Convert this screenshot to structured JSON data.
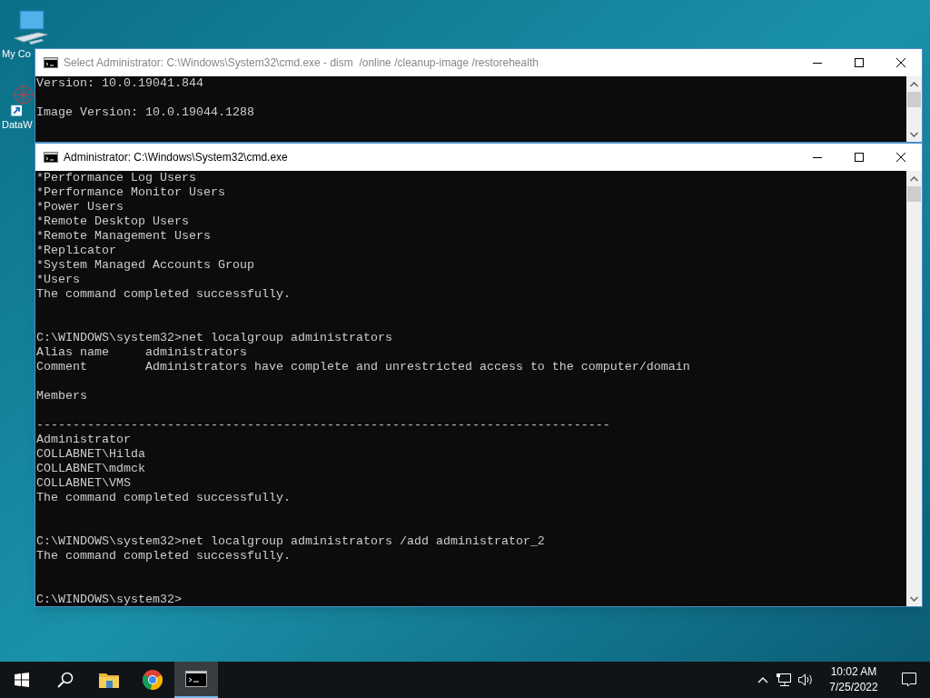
{
  "desktop_icons": [
    {
      "label": "My Co",
      "kind": "computer"
    },
    {
      "label": "DataW",
      "kind": "shortcut"
    }
  ],
  "windows": [
    {
      "title": "Select Administrator: C:\\Windows\\System32\\cmd.exe - dism  /online /cleanup-image /restorehealth",
      "active": false,
      "lines": [
        {
          "kind": "text",
          "text": "Version: 10.0.19041.844"
        },
        {
          "kind": "blank"
        },
        {
          "kind": "text",
          "text": "Image Version: 10.0.19044.1288"
        }
      ]
    },
    {
      "title": "Administrator: C:\\Windows\\System32\\cmd.exe",
      "active": true,
      "lines": [
        {
          "kind": "text",
          "text": "*Performance Log Users"
        },
        {
          "kind": "text",
          "text": "*Performance Monitor Users"
        },
        {
          "kind": "text",
          "text": "*Power Users"
        },
        {
          "kind": "text",
          "text": "*Remote Desktop Users"
        },
        {
          "kind": "text",
          "text": "*Remote Management Users"
        },
        {
          "kind": "text",
          "text": "*Replicator"
        },
        {
          "kind": "text",
          "text": "*System Managed Accounts Group"
        },
        {
          "kind": "text",
          "text": "*Users"
        },
        {
          "kind": "text",
          "text": "The command completed successfully."
        },
        {
          "kind": "blank"
        },
        {
          "kind": "blank"
        },
        {
          "kind": "text",
          "text": "C:\\WINDOWS\\system32>net localgroup administrators"
        },
        {
          "kind": "text",
          "text": "Alias name     administrators"
        },
        {
          "kind": "text",
          "text": "Comment        Administrators have complete and unrestricted access to the computer/domain"
        },
        {
          "kind": "blank"
        },
        {
          "kind": "text",
          "text": "Members"
        },
        {
          "kind": "blank"
        },
        {
          "kind": "text",
          "text": "-------------------------------------------------------------------------------"
        },
        {
          "kind": "text",
          "text": "Administrator"
        },
        {
          "kind": "text",
          "text": "COLLABNET\\Hilda"
        },
        {
          "kind": "text",
          "text": "COLLABNET\\mdmck"
        },
        {
          "kind": "text",
          "text": "COLLABNET\\VMS"
        },
        {
          "kind": "text",
          "text": "The command completed successfully."
        },
        {
          "kind": "blank"
        },
        {
          "kind": "blank"
        },
        {
          "kind": "text",
          "text": "C:\\WINDOWS\\system32>net localgroup administrators /add administrator_2"
        },
        {
          "kind": "text",
          "text": "The command completed successfully."
        },
        {
          "kind": "blank"
        },
        {
          "kind": "blank"
        },
        {
          "kind": "text",
          "text": "C:\\WINDOWS\\system32>"
        }
      ]
    }
  ],
  "taskbar": {
    "apps": [
      {
        "kind": "start",
        "active": false
      },
      {
        "kind": "search",
        "active": false
      },
      {
        "kind": "folder",
        "active": false
      },
      {
        "kind": "browser",
        "active": false
      },
      {
        "kind": "terminal",
        "active": true
      }
    ],
    "clock": {
      "time": "10:02 AM",
      "date": "7/25/2022"
    }
  }
}
